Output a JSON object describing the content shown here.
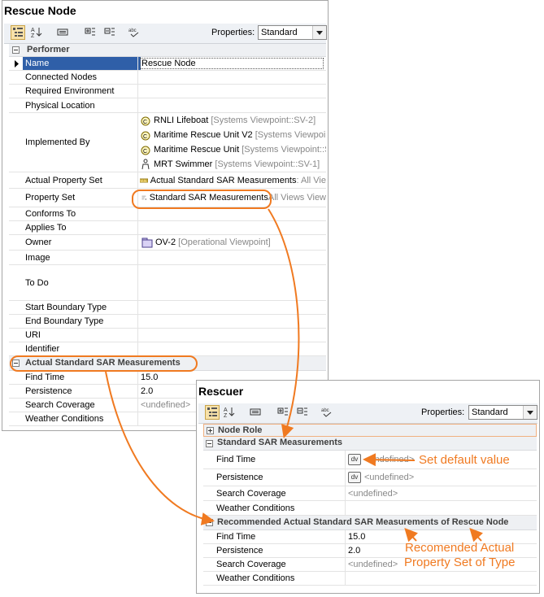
{
  "panel1": {
    "title": "Rescue Node",
    "properties_label": "Properties:",
    "properties_value": "Standard",
    "group_performer": "Performer",
    "rows": {
      "name": {
        "label": "Name",
        "value": "Rescue Node"
      },
      "connected_nodes": {
        "label": "Connected Nodes"
      },
      "required_environment": {
        "label": "Required Environment"
      },
      "physical_location": {
        "label": "Physical Location"
      },
      "implemented_by": {
        "label": "Implemented By",
        "items": [
          {
            "name": "RNLI Lifeboat",
            "path": "[Systems Viewpoint::SV-2]"
          },
          {
            "name": "Maritime Rescue Unit V2",
            "path": "[Systems Viewpoint"
          },
          {
            "name": "Maritime Rescue Unit",
            "path": "[Systems Viewpoint::S"
          },
          {
            "name": "MRT Swimmer",
            "path": "[Systems Viewpoint::SV-1]"
          }
        ]
      },
      "actual_property_set": {
        "label": "Actual Property Set",
        "value": "Actual Standard SAR Measurements",
        "suffix": " : All Vie"
      },
      "property_set": {
        "label": "Property Set",
        "value": "Standard SAR Measurements",
        "suffix": " All Views View"
      },
      "conforms_to": {
        "label": "Conforms To"
      },
      "applies_to": {
        "label": "Applies To"
      },
      "owner": {
        "label": "Owner",
        "value": "OV-2",
        "suffix": "[Operational Viewpoint]"
      },
      "image": {
        "label": "Image"
      },
      "to_do": {
        "label": "To Do"
      },
      "start_boundary": {
        "label": "Start Boundary Type"
      },
      "end_boundary": {
        "label": "End Boundary Type"
      },
      "uri": {
        "label": "URI"
      },
      "identifier": {
        "label": "Identifier"
      }
    },
    "group_actual": "Actual Standard SAR Measurements",
    "actual_rows": [
      {
        "label": "Find Time",
        "value": "15.0"
      },
      {
        "label": "Persistence",
        "value": "2.0"
      },
      {
        "label": "Search Coverage",
        "value": "<undefined>"
      },
      {
        "label": "Weather Conditions",
        "value": ""
      }
    ]
  },
  "panel2": {
    "title": "Rescuer",
    "properties_label": "Properties:",
    "properties_value": "Standard",
    "group_node_role": "Node Role",
    "group_standard": "Standard SAR Measurements",
    "dv_label": "dv",
    "standard_rows": [
      {
        "label": "Find Time",
        "value": "<undefined>"
      },
      {
        "label": "Persistence",
        "value": "<undefined>"
      },
      {
        "label": "Search Coverage",
        "value": "<undefined>"
      },
      {
        "label": "Weather Conditions",
        "value": ""
      }
    ],
    "group_recommended": "Recommended Actual Standard SAR Measurements of Rescue Node",
    "recommended_rows": [
      {
        "label": "Find Time",
        "value": "15.0"
      },
      {
        "label": "Persistence",
        "value": "2.0"
      },
      {
        "label": "Search Coverage",
        "value": "<undefined>"
      },
      {
        "label": "Weather Conditions",
        "value": ""
      }
    ]
  },
  "annotations": {
    "set_default": "Set default value",
    "recommended_line1": "Recomended Actual",
    "recommended_line2": "Property Set of Type"
  },
  "colors": {
    "accent": "#f07a21",
    "selection": "#2f5fa8",
    "group_bg": "#eef0f3"
  }
}
